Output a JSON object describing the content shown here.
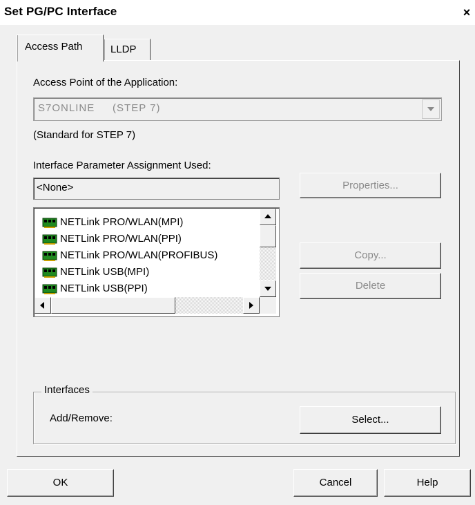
{
  "window": {
    "title": "Set PG/PC Interface",
    "close_symbol": "×"
  },
  "tabs": [
    {
      "label": "Access Path"
    },
    {
      "label": "LLDP"
    }
  ],
  "access_point": {
    "label": "Access Point of the Application:",
    "value": "S7ONLINE     (STEP 7)",
    "note": "(Standard for STEP 7)"
  },
  "interface_param": {
    "label": "Interface Parameter Assignment Used:",
    "value": "<None>"
  },
  "buttons": {
    "properties": "Properties...",
    "copy": "Copy...",
    "delete": "Delete",
    "select": "Select...",
    "ok": "OK",
    "cancel": "Cancel",
    "help": "Help"
  },
  "interface_list": [
    {
      "label": "NETLink PRO/WLAN(MPI)",
      "icon": "network-card-icon"
    },
    {
      "label": "NETLink PRO/WLAN(PPI)",
      "icon": "network-card-icon"
    },
    {
      "label": "NETLink PRO/WLAN(PROFIBUS)",
      "icon": "network-card-icon"
    },
    {
      "label": "NETLink USB(MPI)",
      "icon": "network-card-icon"
    },
    {
      "label": "NETLink USB(PPI)",
      "icon": "network-card-icon"
    }
  ],
  "interfaces_group": {
    "legend": "Interfaces",
    "add_remove_label": "Add/Remove:"
  },
  "colors": {
    "dialog_bg": "#f0f0f0",
    "disabled_text": "#8a8a8a",
    "icon_green": "#1f8a1f"
  }
}
